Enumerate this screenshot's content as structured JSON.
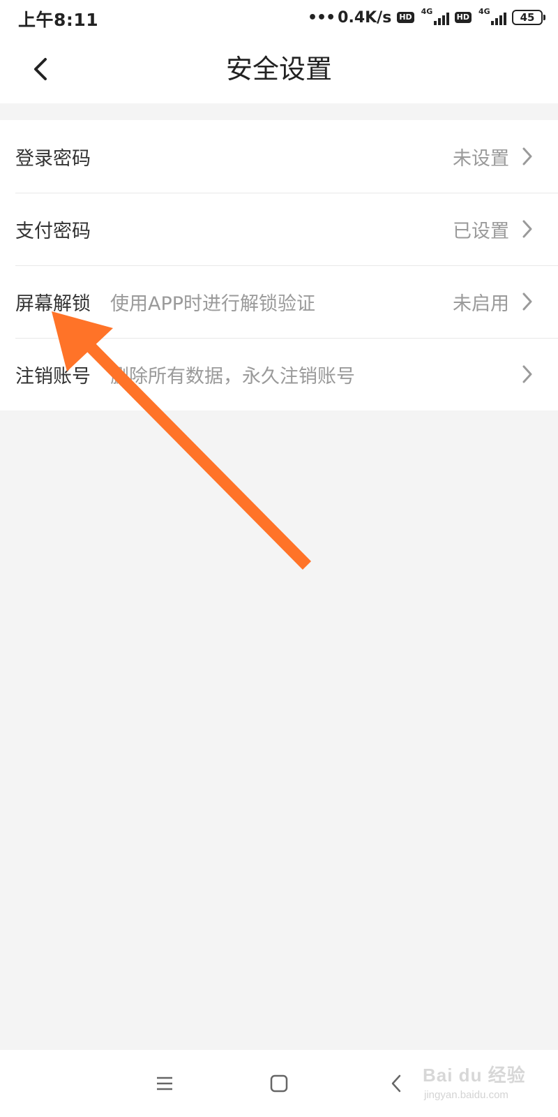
{
  "status_bar": {
    "time": "上午8:11",
    "dots": "•••",
    "net_speed": "0.4K/s",
    "hd_label": "HD",
    "net_type": "4G",
    "battery": "45"
  },
  "header": {
    "title": "安全设置",
    "back_icon": "chevron-left-icon"
  },
  "settings": [
    {
      "label": "登录密码",
      "desc": "",
      "value": "未设置"
    },
    {
      "label": "支付密码",
      "desc": "",
      "value": "已设置"
    },
    {
      "label": "屏幕解锁",
      "desc": "使用APP时进行解锁验证",
      "value": "未启用"
    },
    {
      "label": "注销账号",
      "desc": "删除所有数据，永久注销账号",
      "value": ""
    }
  ],
  "bottom_nav": {
    "menu_icon": "menu-icon",
    "home_icon": "home-square-icon",
    "back_icon": "back-triangle-icon"
  },
  "watermark": {
    "main": "Bai du 经验",
    "sub": "jingyan.baidu.com"
  },
  "colors": {
    "background": "#f4f4f4",
    "card": "#ffffff",
    "text_primary": "#333333",
    "text_secondary": "#9a9a9a",
    "arrow": "#ff7328"
  }
}
